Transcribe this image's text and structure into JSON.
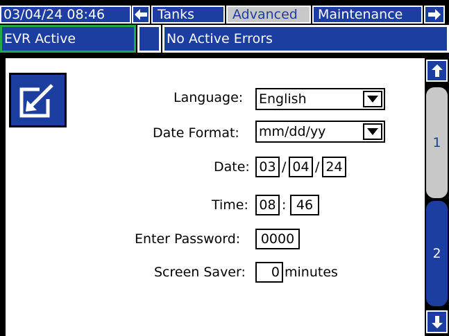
{
  "header": {
    "datetime": "03/04/24 08:46",
    "tabs": [
      {
        "label": "Tanks",
        "active": false
      },
      {
        "label": "Advanced",
        "active": true
      },
      {
        "label": "Maintenance",
        "active": false
      }
    ],
    "left_arrow_icon": "arrow-left-icon",
    "right_arrow_icon": "arrow-right-icon"
  },
  "status": {
    "evr": "EVR Active",
    "errors": "No Active Errors"
  },
  "screen_icon": "edit-setup-icon",
  "form": {
    "language_label": "Language:",
    "language_value": "English",
    "date_format_label": "Date Format:",
    "date_format_value": "mm/dd/yy",
    "date_label": "Date:",
    "date_month": "03",
    "date_day": "04",
    "date_year": "24",
    "date_sep": "/",
    "time_label": "Time:",
    "time_hour": "08",
    "time_minute": "46",
    "time_sep": ":",
    "password_label": "Enter Password:",
    "password_value": "0000",
    "screensaver_label": "Screen Saver:",
    "screensaver_value": "0",
    "screensaver_unit": "minutes"
  },
  "pager": {
    "up_icon": "arrow-up-icon",
    "down_icon": "arrow-down-icon",
    "pages": [
      {
        "label": "1",
        "active": true
      },
      {
        "label": "2",
        "active": false
      }
    ]
  },
  "colors": {
    "blue": "#1c3ea0",
    "panel": "#ffffff",
    "active_tab": "#c8c8c8",
    "evr_border": "#22a845"
  }
}
